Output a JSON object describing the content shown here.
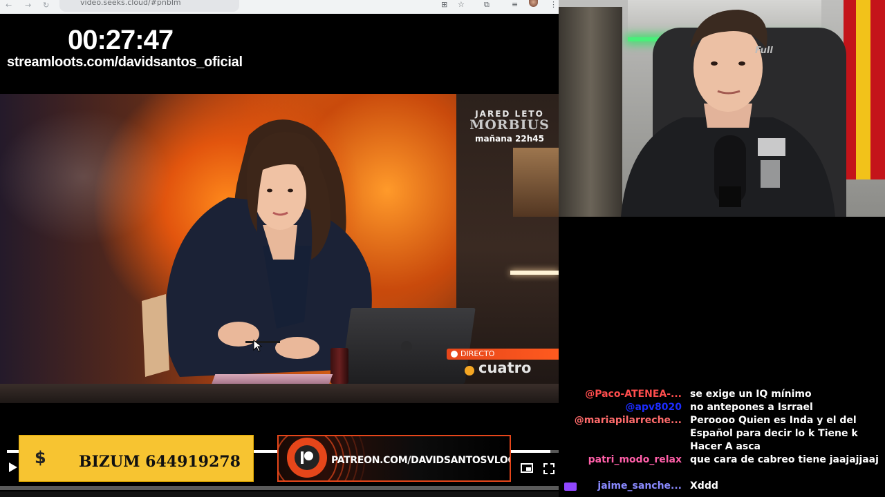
{
  "browser": {
    "url": "video.seeks.cloud/#pnblm"
  },
  "overlay": {
    "timer": "00:27:47",
    "streamloots": "streamloots.com/davidsantos_oficial"
  },
  "video": {
    "promo_actor": "JARED LETO",
    "promo_title": "MORBIUS",
    "promo_time": "mañana 22h45",
    "live_badge": "DIRECTO",
    "channel": "cuatro",
    "progress_fraction": 0.985
  },
  "banners": {
    "bizum_symbol": "$",
    "bizum": "BIZUM 644919278",
    "patreon": "PATREON.COM/DAVIDSANTOSVLOG"
  },
  "webcam": {
    "chair_brand": "Full"
  },
  "chat": [
    {
      "user": "@Paco-ATENEA-...",
      "color": "#ff4d4d",
      "message": "se exige un IQ mínimo"
    },
    {
      "user": "@apv8020",
      "color": "#1c2cff",
      "message": "no antepones a Isrrael"
    },
    {
      "user": "@mariapilarreche...",
      "color": "#ff6b6b",
      "message": "Peroooo Quien es Inda y el del Español para decir lo k Tiene k Hacer A asca"
    },
    {
      "user": "patri_modo_relax",
      "color": "#ff5fa8",
      "message": "que cara de cabreo tiene jaajajjaaj"
    },
    {
      "user": "jaime_sanche...",
      "color": "#8a8aff",
      "message": "Xddd"
    }
  ],
  "colors": {
    "accent": "#e6461a",
    "bizum": "#f7c431"
  }
}
